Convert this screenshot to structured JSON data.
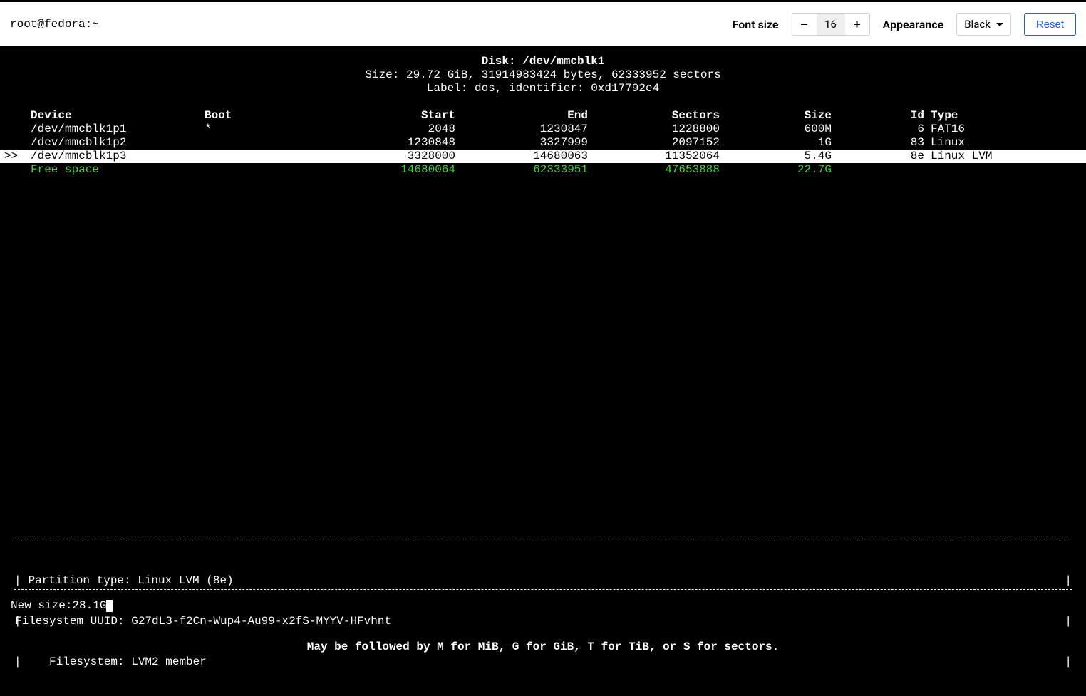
{
  "header": {
    "title": "root@fedora:~",
    "font_size_label": "Font size",
    "font_size_value": "16",
    "appearance_label": "Appearance",
    "appearance_value": "Black",
    "reset_label": "Reset",
    "minus": "−",
    "plus": "+"
  },
  "disk": {
    "title_label": "Disk: ",
    "title_value": "/dev/mmcblk1",
    "size_line": "Size: 29.72 GiB, 31914983424 bytes, 62333952 sectors",
    "label_line": "Label: dos, identifier: 0xd17792e4"
  },
  "columns": {
    "device": "Device",
    "boot": "Boot",
    "start": "Start",
    "end": "End",
    "sectors": "Sectors",
    "size": "Size",
    "id": "Id",
    "type": "Type"
  },
  "rows": [
    {
      "marker": "",
      "device": "/dev/mmcblk1p1",
      "boot": "*",
      "start": "2048",
      "end": "1230847",
      "sectors": "1228800",
      "size": "600M",
      "id": "6",
      "type": "FAT16",
      "selected": false,
      "free": false
    },
    {
      "marker": "",
      "device": "/dev/mmcblk1p2",
      "boot": "",
      "start": "1230848",
      "end": "3327999",
      "sectors": "2097152",
      "size": "1G",
      "id": "83",
      "type": "Linux",
      "selected": false,
      "free": false
    },
    {
      "marker": ">>",
      "device": "/dev/mmcblk1p3",
      "boot": "",
      "start": "3328000",
      "end": "14680063",
      "sectors": "11352064",
      "size": "5.4G",
      "id": "8e",
      "type": "Linux LVM",
      "selected": true,
      "free": false
    },
    {
      "marker": "",
      "device": "Free space",
      "boot": "",
      "start": "14680064",
      "end": "62333951",
      "sectors": "47653888",
      "size": "22.7G",
      "id": "",
      "type": "",
      "selected": false,
      "free": true
    }
  ],
  "info_box": {
    "line1": " Partition type: Linux LVM (8e)",
    "line2": "Filesystem UUID: G27dL3-f2Cn-Wup4-Au99-x2fS-MYYV-HFvhnt",
    "line3": "     Filesystem: LVM2 member"
  },
  "prompt": {
    "label": "New size: ",
    "value": "28.1G"
  },
  "hint": "May be followed by M for MiB, G for GiB, T for TiB, or S for sectors."
}
